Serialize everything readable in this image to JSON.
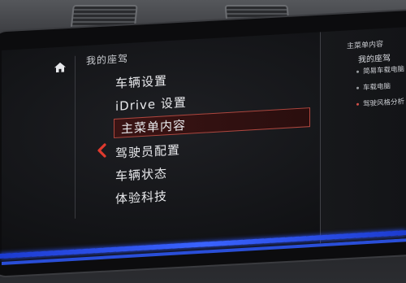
{
  "main_menu": {
    "title": "我的座驾",
    "items": [
      {
        "label": "车辆设置"
      },
      {
        "label": "iDrive 设置"
      },
      {
        "label": "主菜单内容"
      },
      {
        "label": "驾驶员配置"
      },
      {
        "label": "车辆状态"
      },
      {
        "label": "体验科技"
      }
    ],
    "selected_index": 2
  },
  "side_panel": {
    "header": "主菜单内容",
    "title": "我的座驾",
    "items": [
      {
        "label": "简易车载电脑"
      },
      {
        "label": "车载电脑"
      },
      {
        "label": "驾驶风格分析"
      }
    ]
  },
  "colors": {
    "selection_border": "#b0463e",
    "back_arrow": "#e03a2e",
    "ambient_strip": "#2e55ff"
  },
  "icons": {
    "home": "home-icon",
    "back": "chevron-left-icon"
  }
}
